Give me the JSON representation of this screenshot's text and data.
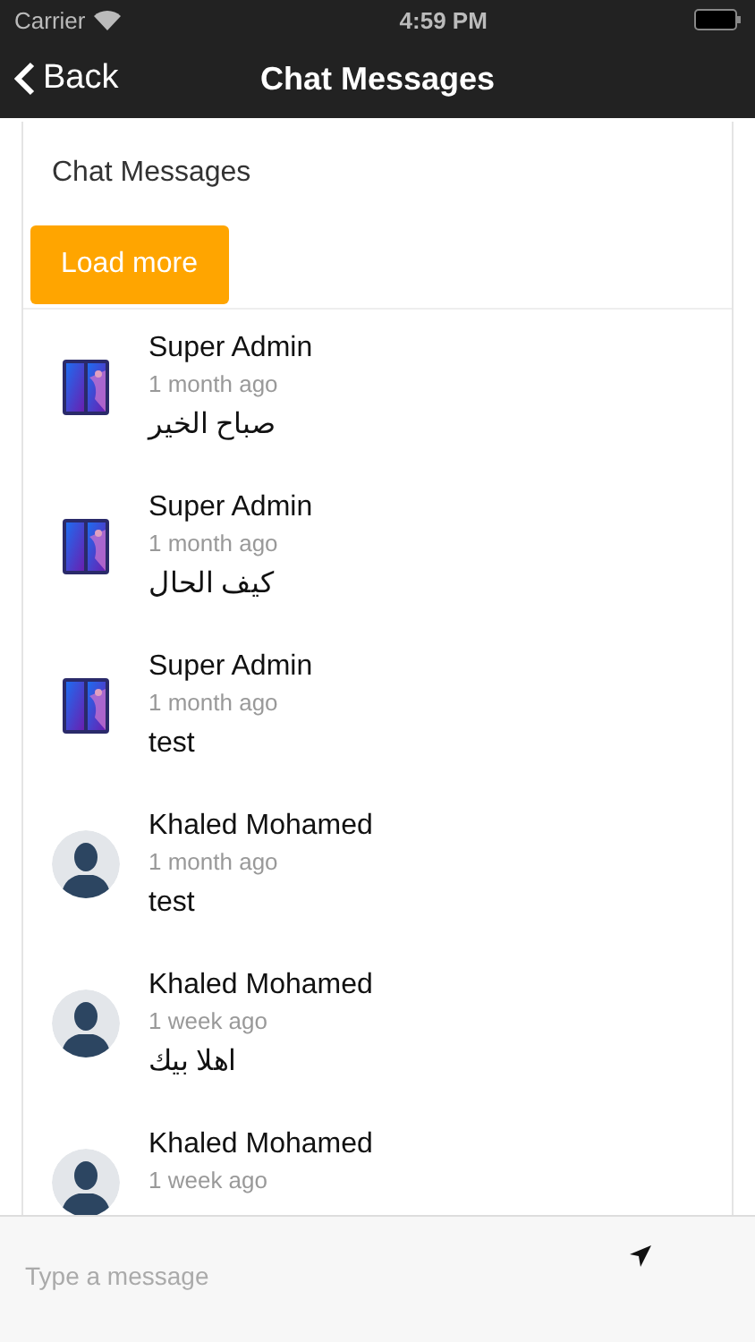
{
  "status_bar": {
    "carrier": "Carrier",
    "time": "4:59 PM"
  },
  "nav_bar": {
    "back": "Back",
    "title": "Chat Messages"
  },
  "card": {
    "title": "Chat Messages",
    "load_more": "Load more"
  },
  "messages": [
    {
      "name": "Super Admin",
      "time": "1 month ago",
      "text": "صباح الخير"
    },
    {
      "name": "Super Admin",
      "time": "1 month ago",
      "text": "كيف الحال"
    },
    {
      "name": "Super Admin",
      "time": "1 month ago",
      "text": "test"
    },
    {
      "kind": "person",
      "name": "Khaled Mohamed",
      "time": "1 month ago",
      "text": "test"
    },
    {
      "kind": "person",
      "name": "Khaled Mohamed",
      "time": "1 week ago",
      "text": "اهلا بيك"
    },
    {
      "kind": "person",
      "name": "Khaled Mohamed",
      "time": "1 week ago"
    }
  ],
  "composer": {
    "placeholder": "Type a message"
  }
}
